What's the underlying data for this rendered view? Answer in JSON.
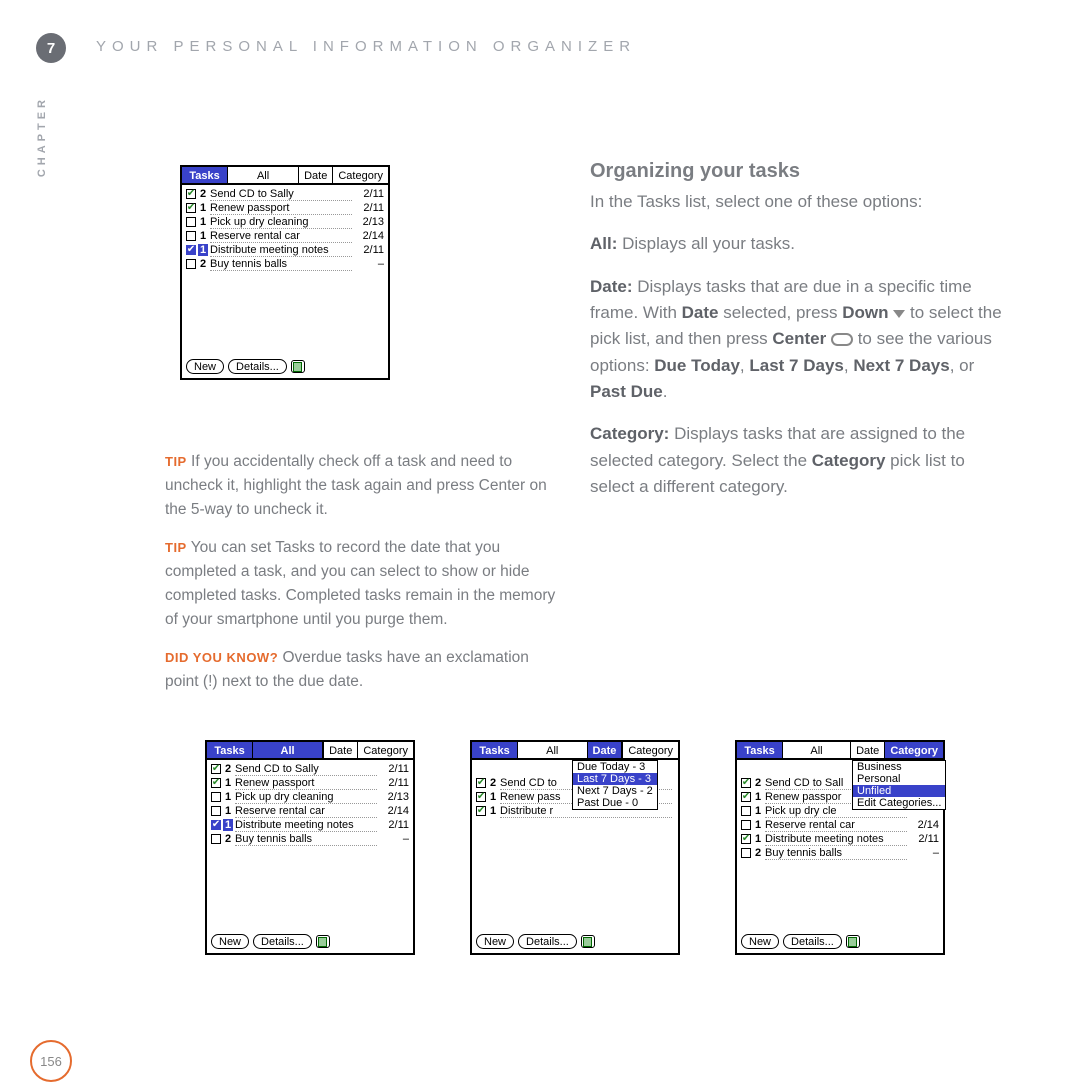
{
  "header": {
    "chapter_num": "7",
    "chapter_title": "YOUR PERSONAL INFORMATION ORGANIZER",
    "side_label": "CHAPTER",
    "page_number": "156"
  },
  "tips": {
    "tip_label": "TIP",
    "dyk_label": "DID YOU KNOW?",
    "tip1": "If you accidentally check off a task and need to uncheck it, highlight the task again and press Center on the 5-way to uncheck it.",
    "tip2": "You can set Tasks to record the date that you completed a task, and you can select to show or hide completed tasks. Completed tasks remain in the memory of your smartphone until you purge them.",
    "dyk": "Overdue tasks have an exclamation point (!) next to the due date."
  },
  "right": {
    "heading": "Organizing your tasks",
    "intro": "In the Tasks list, select one of these options:",
    "all_label": "All:",
    "all_text": " Displays all your tasks.",
    "date_label": "Date:",
    "date_text1": " Displays tasks that are due in a specific time frame. With ",
    "date_bold1": "Date",
    "date_text2": " selected, press ",
    "date_bold2": "Down",
    "date_text3": " to select the pick list, and then press ",
    "date_bold3": "Center",
    "date_text4": " to see the various options: ",
    "date_bold4": "Due Today",
    "date_sep": ", ",
    "date_bold5": "Last 7 Days",
    "date_bold6": "Next 7 Days",
    "date_or": ", or ",
    "date_bold7": "Past Due",
    "date_end": ".",
    "cat_label": "Category:",
    "cat_text1": " Displays tasks that are assigned to the selected category. Select the ",
    "cat_bold": "Category",
    "cat_text2": " pick list to select a different category."
  },
  "palm": {
    "tabs": {
      "tasks": "Tasks",
      "all": "All",
      "date": "Date",
      "category": "Category"
    },
    "buttons": {
      "new": "New",
      "details": "Details..."
    },
    "tasks": [
      {
        "checked": true,
        "pri": "2",
        "text": "Send CD to Sally",
        "date": "2/11"
      },
      {
        "checked": true,
        "pri": "1",
        "text": "Renew passport",
        "date": "2/11"
      },
      {
        "checked": false,
        "pri": "1",
        "text": "Pick up dry cleaning",
        "date": "2/13"
      },
      {
        "checked": false,
        "pri": "1",
        "text": "Reserve rental car",
        "date": "2/14"
      },
      {
        "checked": true,
        "pri": "1",
        "text": "Distribute meeting notes",
        "date": "2/11",
        "selected": true
      },
      {
        "checked": false,
        "pri": "2",
        "text": "Buy tennis balls",
        "date": "–"
      }
    ],
    "date_dropdown": [
      "Due Today - 3",
      "Last 7 Days - 3",
      "Next 7 Days - 2",
      "Past Due - 0"
    ],
    "date_tasks_trunc": [
      {
        "checked": true,
        "pri": "2",
        "text": "Send CD to"
      },
      {
        "checked": true,
        "pri": "1",
        "text": "Renew pass"
      },
      {
        "checked": true,
        "pri": "1",
        "text": "Distribute r"
      }
    ],
    "cat_dropdown": [
      "Business",
      "Personal",
      "Unfiled",
      "Edit Categories..."
    ],
    "cat_tasks": [
      {
        "checked": true,
        "pri": "2",
        "text": "Send CD to Sall",
        "date": ""
      },
      {
        "checked": true,
        "pri": "1",
        "text": "Renew passpor",
        "date": ""
      },
      {
        "checked": false,
        "pri": "1",
        "text": "Pick up dry cle",
        "date": ""
      },
      {
        "checked": false,
        "pri": "1",
        "text": "Reserve rental car",
        "date": "2/14"
      },
      {
        "checked": true,
        "pri": "1",
        "text": "Distribute meeting notes",
        "date": "2/11"
      },
      {
        "checked": false,
        "pri": "2",
        "text": "Buy tennis balls",
        "date": "–"
      }
    ]
  }
}
